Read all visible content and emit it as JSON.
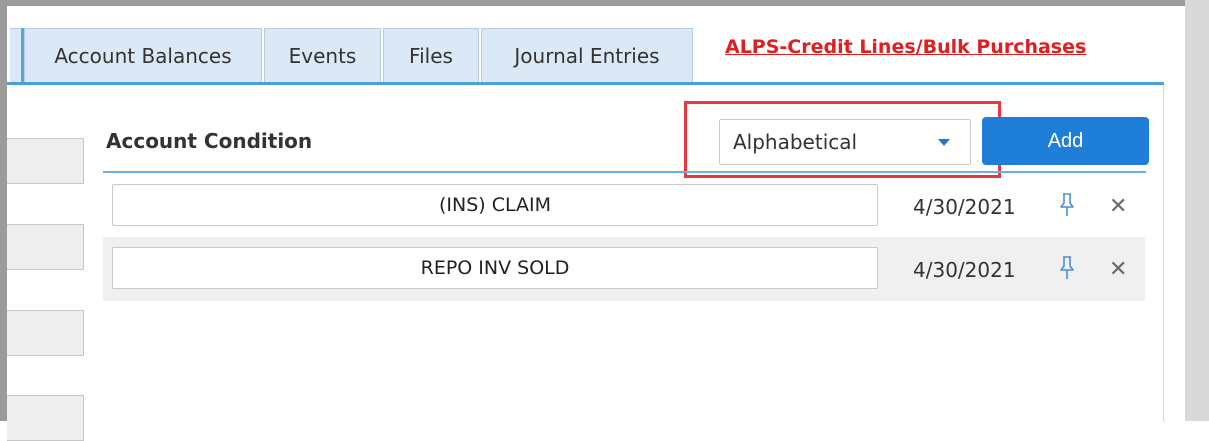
{
  "tabs": [
    {
      "label": "Account Balances"
    },
    {
      "label": "Events"
    },
    {
      "label": "Files"
    },
    {
      "label": "Journal Entries"
    }
  ],
  "alps_link": "ALPS-Credit Lines/Bulk Purchases",
  "section": {
    "title": "Account Condition",
    "sort_value": "Alphabetical",
    "add_label": "Add"
  },
  "conditions": [
    {
      "name": "(INS) CLAIM",
      "date": "4/30/2021"
    },
    {
      "name": "REPO INV SOLD",
      "date": "4/30/2021"
    }
  ],
  "icons": {
    "pin": "pin-icon",
    "close": "close-icon",
    "caret": "chevron-down-icon"
  },
  "colors": {
    "accent": "#1f7fd8",
    "tab_bg": "#dbe9f6",
    "link": "#e02020",
    "highlight": "#e8383d"
  }
}
